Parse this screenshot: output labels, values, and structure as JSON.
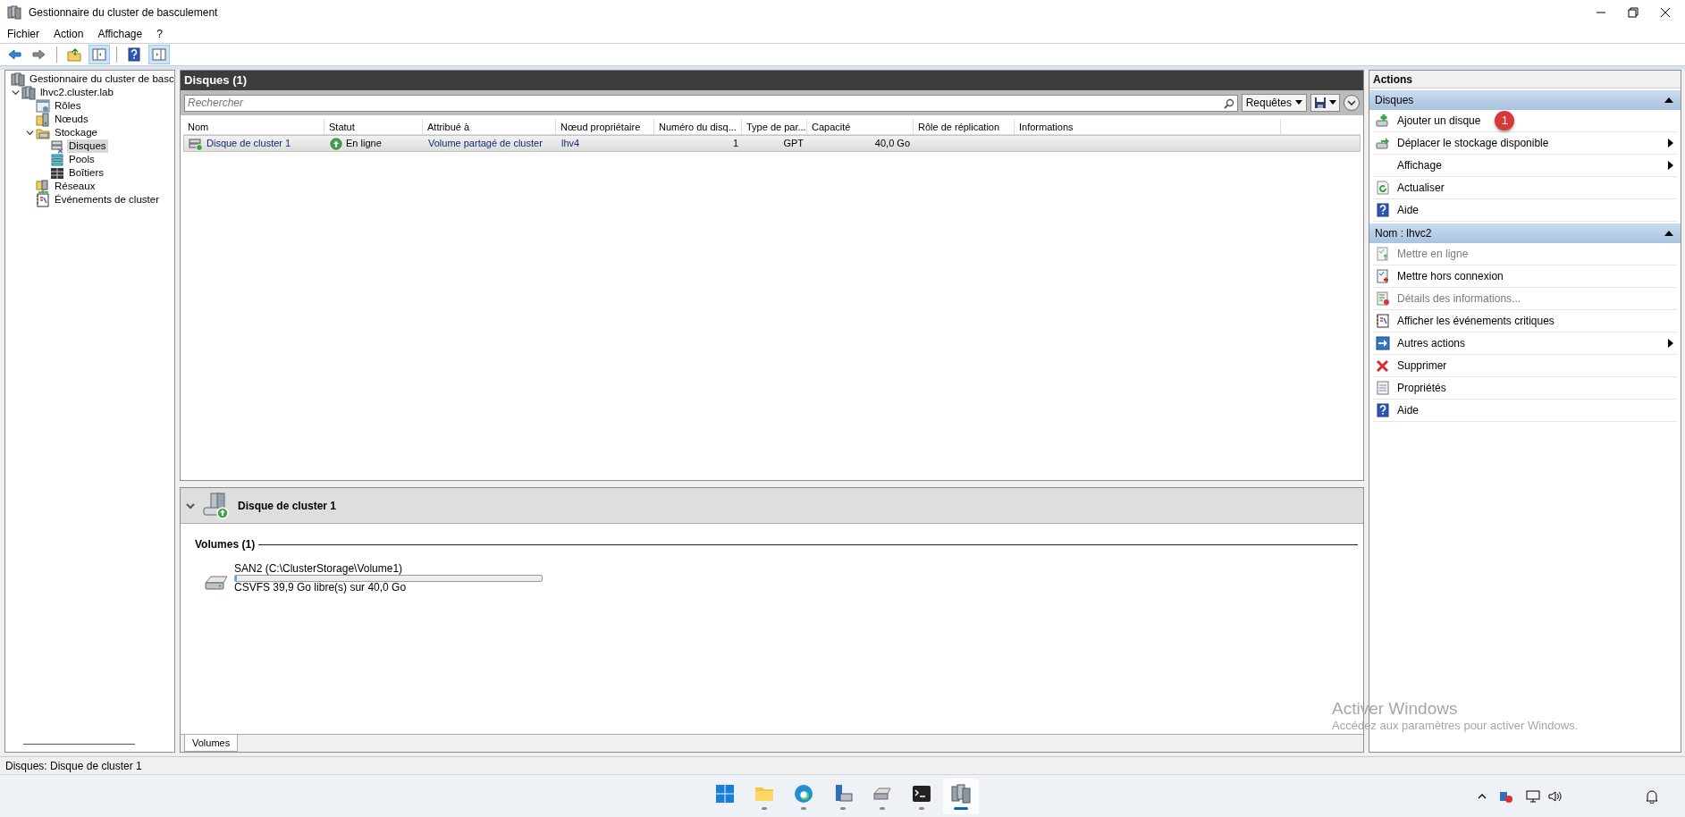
{
  "window": {
    "title": "Gestionnaire du cluster de basculement"
  },
  "menu": [
    "Fichier",
    "Action",
    "Affichage",
    "?"
  ],
  "toolbar": [
    {
      "kind": "back",
      "pressed": false
    },
    {
      "kind": "forward",
      "pressed": false
    },
    {
      "kind": "sep"
    },
    {
      "kind": "up",
      "pressed": false
    },
    {
      "kind": "tree-pane",
      "pressed": true
    },
    {
      "kind": "sep"
    },
    {
      "kind": "help",
      "pressed": false
    },
    {
      "kind": "action-pane",
      "pressed": true
    }
  ],
  "tree": [
    {
      "label": "Gestionnaire du cluster de basc",
      "kind": "cluster",
      "selected": false,
      "children": [
        {
          "label": "lhvc2.cluster.lab",
          "kind": "cluster",
          "selected": false,
          "expanded": true,
          "children": [
            {
              "label": "Rôles",
              "kind": "roles",
              "selected": false
            },
            {
              "label": "Nœuds",
              "kind": "nodes",
              "selected": false
            },
            {
              "label": "Stockage",
              "kind": "storage",
              "selected": false,
              "expanded": true,
              "children": [
                {
                  "label": "Disques",
                  "kind": "disks",
                  "selected": true
                },
                {
                  "label": "Pools",
                  "kind": "pools",
                  "selected": false
                },
                {
                  "label": "Boîtiers",
                  "kind": "enclosures",
                  "selected": false
                }
              ]
            },
            {
              "label": "Réseaux",
              "kind": "networks",
              "selected": false
            },
            {
              "label": "Événements de cluster",
              "kind": "events",
              "selected": false
            }
          ]
        }
      ]
    }
  ],
  "list": {
    "title": "Disques (1)",
    "search": {
      "placeholder": "Rechercher"
    },
    "queries_button": "Requêtes",
    "columns": [
      "Nom",
      "Statut",
      "Attribué à",
      "Nœud propriétaire",
      "Numéro du disq...",
      "Type de par...",
      "Capacité",
      "Rôle de réplication",
      "Informations"
    ],
    "rows": [
      {
        "selected": true,
        "kind": "disk",
        "cells": [
          "Disque de cluster 1",
          "En ligne",
          "Volume partagé de cluster",
          "lhv4",
          "1",
          "GPT",
          "40,0 Go",
          "",
          ""
        ]
      }
    ]
  },
  "detail": {
    "title": "Disque de cluster 1",
    "section": "Volumes (1)",
    "volumes": [
      {
        "name": "SAN2 (C:\\ClusterStorage\\Volume1)",
        "level": 0.0025,
        "info": "CSVFS 39,9 Go libre(s) sur 40,0 Go"
      }
    ],
    "tabs": [
      {
        "label": "Volumes",
        "selected": true
      }
    ]
  },
  "actions": {
    "title": "Actions",
    "sections": [
      {
        "title": "Disques",
        "expanded": true,
        "items": [
          {
            "label": "Ajouter un disque",
            "kind": "add-disk",
            "disabled": false,
            "submenu": false,
            "callout": "1"
          },
          {
            "label": "Déplacer le stockage disponible",
            "kind": "move-disk",
            "disabled": false,
            "submenu": true
          },
          {
            "label": "Affichage",
            "kind": "none",
            "disabled": false,
            "submenu": true
          },
          {
            "label": "Actualiser",
            "kind": "refresh",
            "disabled": false,
            "submenu": false
          },
          {
            "label": "Aide",
            "kind": "help",
            "disabled": false,
            "submenu": false
          }
        ]
      },
      {
        "title": "Nom : lhvc2",
        "expanded": true,
        "items": [
          {
            "label": "Mettre en ligne",
            "kind": "online-action",
            "disabled": true,
            "submenu": false
          },
          {
            "label": "Mettre hors connexion",
            "kind": "offline-action",
            "disabled": false,
            "submenu": false
          },
          {
            "label": "Détails des informations...",
            "kind": "details",
            "disabled": true,
            "submenu": false
          },
          {
            "label": "Afficher les événements critiques",
            "kind": "events",
            "disabled": false,
            "submenu": false
          },
          {
            "label": "Autres actions",
            "kind": "more",
            "disabled": false,
            "submenu": true
          },
          {
            "label": "Supprimer",
            "kind": "delete",
            "disabled": false,
            "submenu": false
          },
          {
            "label": "Propriétés",
            "kind": "properties",
            "disabled": false,
            "submenu": false
          },
          {
            "label": "Aide",
            "kind": "help",
            "disabled": false,
            "submenu": false
          }
        ]
      }
    ]
  },
  "status_bar": "Disques:  Disque de cluster 1",
  "activation_notice": {
    "title": "Activer Windows",
    "text": "Accédez aux paramètres pour activer Windows."
  },
  "taskbar": {
    "apps": [
      {
        "kind": "start",
        "active": false,
        "running": false
      },
      {
        "kind": "folder",
        "active": false,
        "running": true
      },
      {
        "kind": "browser",
        "active": false,
        "running": true
      },
      {
        "kind": "server-manager",
        "active": false,
        "running": true
      },
      {
        "kind": "disk-tool",
        "active": false,
        "running": true
      },
      {
        "kind": "terminal",
        "active": false,
        "running": true
      },
      {
        "kind": "cluster",
        "active": true,
        "running": true
      }
    ]
  }
}
